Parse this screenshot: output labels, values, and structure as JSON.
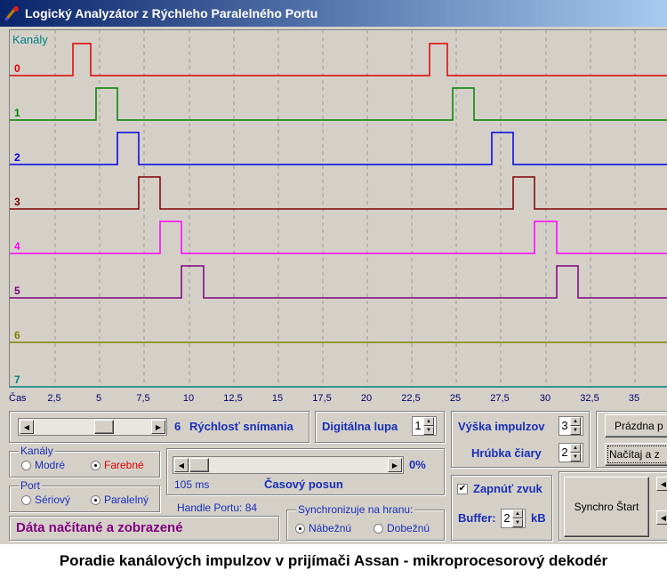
{
  "window": {
    "title": "Logický Analyzátor z Rýchleho Paralelného Portu"
  },
  "scope": {
    "channels_label": "Kanály",
    "channels": [
      {
        "label": "0",
        "color": "#e00000",
        "pulses": [
          [
            3.5,
            4.5
          ],
          [
            23.5,
            24.5
          ]
        ]
      },
      {
        "label": "1",
        "color": "#008000",
        "pulses": [
          [
            4.8,
            6.0
          ],
          [
            24.8,
            26.0
          ]
        ]
      },
      {
        "label": "2",
        "color": "#0000e8",
        "pulses": [
          [
            6.0,
            7.2
          ],
          [
            27.0,
            28.2
          ]
        ]
      },
      {
        "label": "3",
        "color": "#800000",
        "pulses": [
          [
            7.2,
            8.4
          ],
          [
            28.2,
            29.4
          ]
        ]
      },
      {
        "label": "4",
        "color": "#ff00ff",
        "pulses": [
          [
            8.4,
            9.6
          ],
          [
            29.4,
            30.6
          ]
        ]
      },
      {
        "label": "5",
        "color": "#800080",
        "pulses": [
          [
            9.6,
            10.8
          ],
          [
            30.6,
            31.8
          ]
        ]
      },
      {
        "label": "6",
        "color": "#808000",
        "pulses": []
      },
      {
        "label": "7",
        "color": "#008080",
        "pulses": []
      }
    ],
    "axis_label": "Čas",
    "ticks": [
      "2,5",
      "5",
      "7,5",
      "10",
      "12,5",
      "15",
      "17,5",
      "20",
      "22,5",
      "25",
      "27,5",
      "30",
      "32,5",
      "35"
    ]
  },
  "controls": {
    "speed_value": "6",
    "speed_label": "Rýchlosť snímania",
    "zoom_label": "Digitálna lupa",
    "zoom_value": "1",
    "pulse_height_label": "Výška impulzov",
    "pulse_height_value": "3",
    "line_width_label": "Hrúbka čiary",
    "line_width_value": "2",
    "empty_button": "Prázdna p",
    "load_button": "Načítaj a z",
    "channels_group": "Kanály",
    "blue_option": "Modré",
    "color_option": "Farebné",
    "port_group": "Port",
    "serial_option": "Sériový",
    "parallel_option": "Paralelný",
    "shift_percent": "0%",
    "shift_ms": "105 ms",
    "shift_label": "Časový posun",
    "handle_label": "Handle Portu: 84",
    "sync_group": "Synchronizuje na hranu:",
    "rising_option": "Nábežnú",
    "falling_option": "Dobežnú",
    "sound_label": "Zapnúť zvuk",
    "buffer_label": "Buffer:",
    "buffer_value": "2",
    "buffer_unit": "kB",
    "synchro_button": "Synchro Štart",
    "status": "Dáta načítané a zobrazené"
  },
  "caption": "Poradie kanálových impulzov v prijímači Assan - mikroprocesorový dekodér"
}
